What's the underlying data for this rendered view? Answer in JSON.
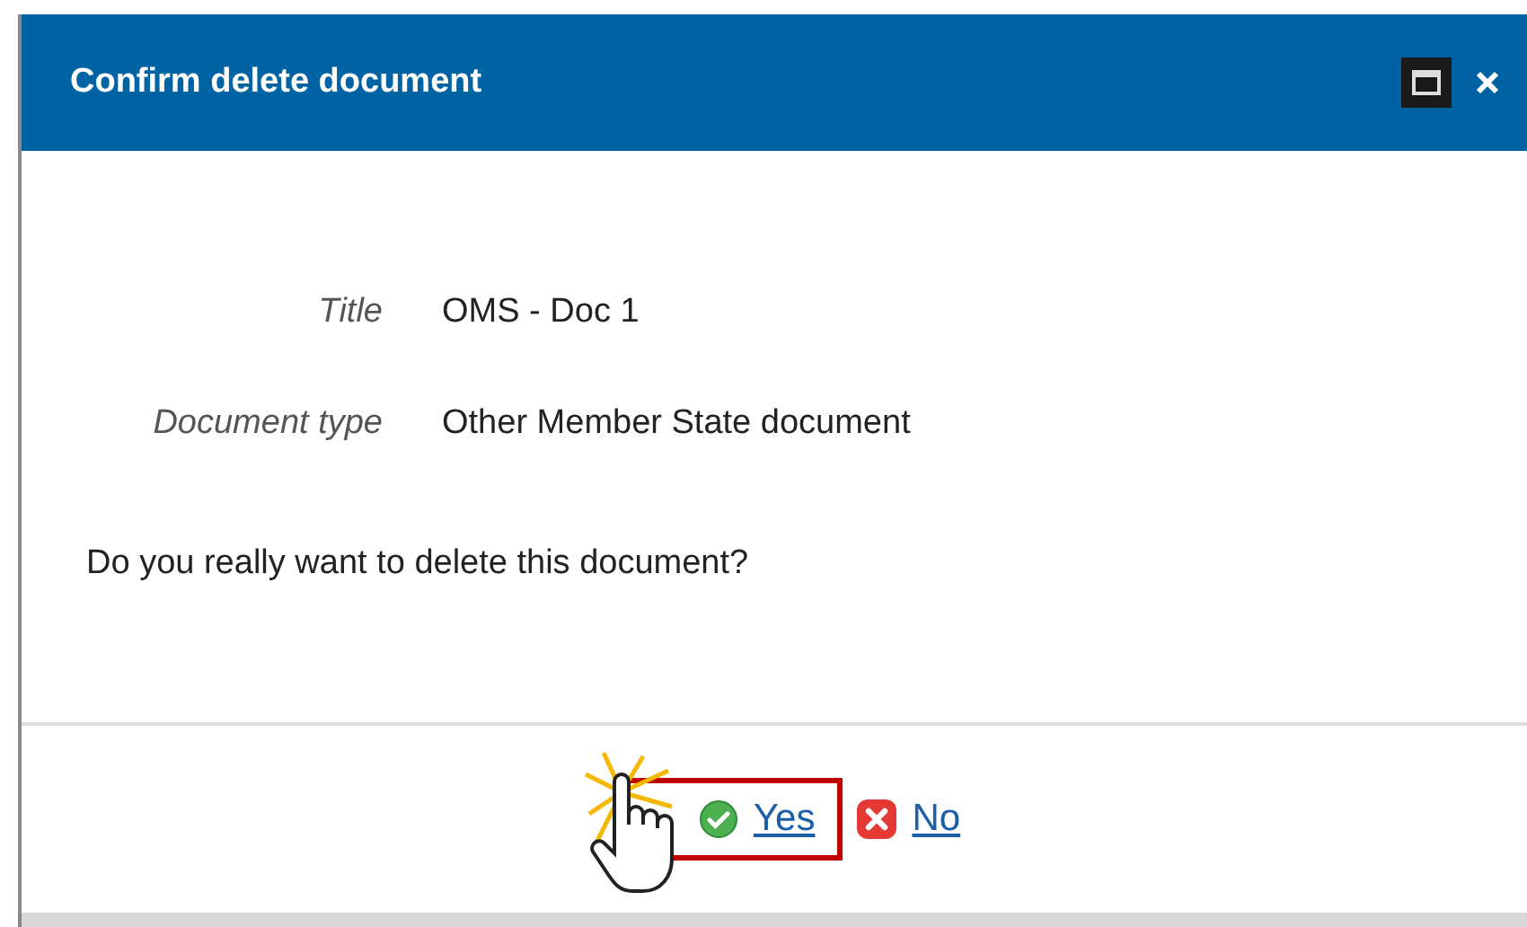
{
  "dialog": {
    "title": "Confirm delete document"
  },
  "fields": [
    {
      "label": "Title",
      "value": "OMS - Doc 1"
    },
    {
      "label": "Document type",
      "value": "Other Member State document"
    }
  ],
  "question": "Do you really want to delete this document?",
  "buttons": [
    {
      "kind": "yes",
      "label": "Yes",
      "highlighted": true
    },
    {
      "kind": "no",
      "label": "No",
      "highlighted": false
    }
  ]
}
